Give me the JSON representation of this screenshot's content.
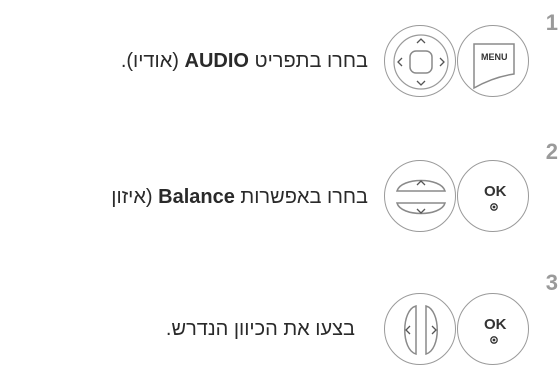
{
  "steps": [
    {
      "number": "1",
      "text_after": "(אודיו).",
      "text_bold": "AUDIO",
      "text_before": "בחרו בתפריט",
      "buttons": {
        "right_label": "MENU",
        "left": "navigation-pad-all-directions"
      }
    },
    {
      "number": "2",
      "text_after": "(איזון",
      "text_bold": "Balance",
      "text_before": "בחרו באפשרות",
      "buttons": {
        "right_label": "OK",
        "left": "navigation-pad-up-down"
      }
    },
    {
      "number": "3",
      "text_full": "בצעו את הכיוון הנדרש.",
      "buttons": {
        "right_label": "OK",
        "left": "navigation-pad-left-right"
      }
    }
  ]
}
